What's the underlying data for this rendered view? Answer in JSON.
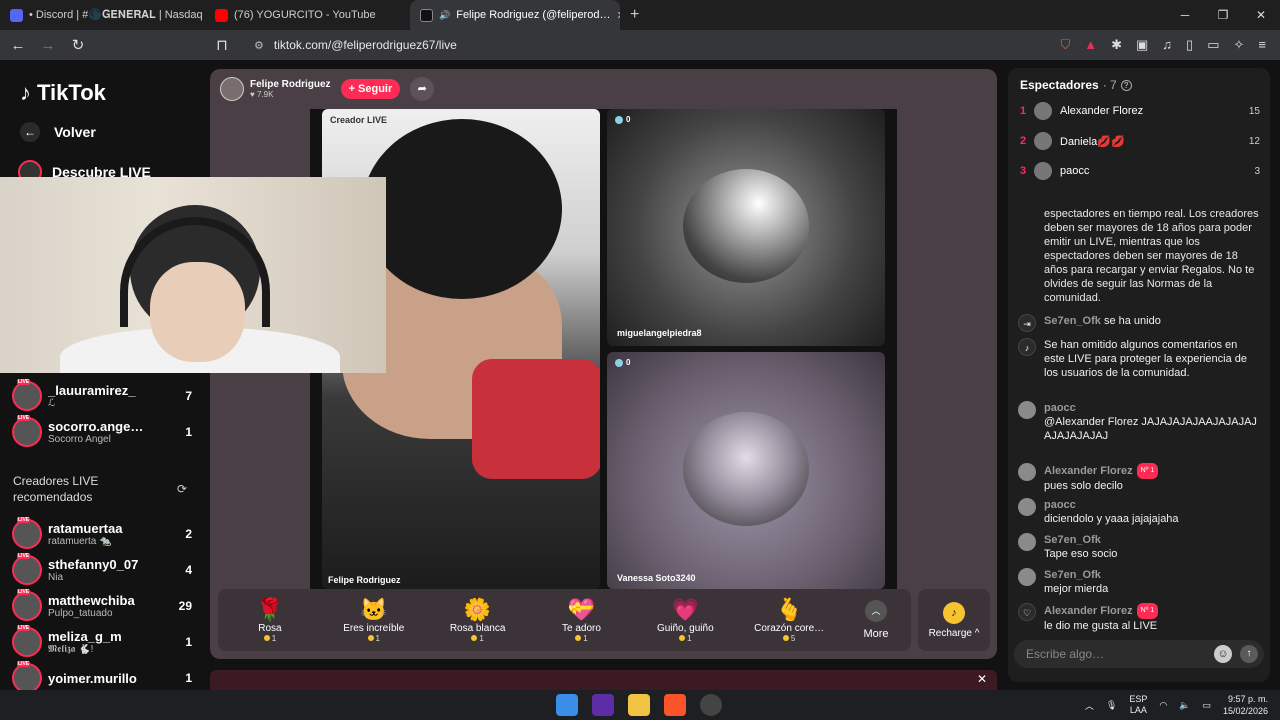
{
  "browser": {
    "tabs": [
      {
        "label": "• Discord | #🌑𝐆𝐄𝐍𝐄𝐑𝐀𝐋 | Nasdaq",
        "icon": "discord-icon",
        "color": "#5865f2"
      },
      {
        "label": "(76) YOGURCITO - YouTube",
        "icon": "youtube-icon",
        "color": "#ff0000"
      },
      {
        "label": "Felipe Rodriguez (@feliperod…",
        "icon": "tiktok-icon",
        "color": "#111111"
      }
    ],
    "new_tab": "+",
    "url": "tiktok.com/@feliperodriguez67/live",
    "shield_count": "7"
  },
  "sidebar": {
    "logo": "TikTok",
    "back": "Volver",
    "discover": "Descubre LIVE",
    "following": [
      {
        "name": "_lauuramirez_",
        "sub": "ℒ",
        "count": "7"
      },
      {
        "name": "socorro.ange…",
        "sub": "Socorro Angel",
        "count": "1"
      }
    ],
    "rec_title": "Creadores LIVE recomendados",
    "recommended": [
      {
        "name": "ratamuertaa",
        "sub": "ratamuerta 🐀",
        "count": "2"
      },
      {
        "name": "sthefanny0_07",
        "sub": "Nia",
        "count": "4"
      },
      {
        "name": "matthewchiba",
        "sub": "Pulpo_tatuado",
        "count": "29"
      },
      {
        "name": "meliza_g_m",
        "sub": "𝕸𝖊𝖑𝖎𝖟𝖆 🐇!",
        "count": "1"
      },
      {
        "name": "yoimer.murillo",
        "sub": "",
        "count": "1"
      }
    ]
  },
  "stream": {
    "host_name": "Felipe Rodriguez",
    "host_likes": "♥ 7.9K",
    "follow": "+ Seguir",
    "creator_tag": "Creador LIVE",
    "host_label": "Felipe Rodriguez",
    "guest1": {
      "name": "miguelangelpiedra8",
      "viewers": "0"
    },
    "guest2": {
      "name": "Vanessa Soto3240",
      "viewers": "0"
    }
  },
  "gifts": [
    {
      "name": "Rosa",
      "icon": "🌹",
      "cost": "1"
    },
    {
      "name": "Eres increíble",
      "icon": "🐱",
      "cost": "1"
    },
    {
      "name": "Rosa blanca",
      "icon": "🌼",
      "cost": "1"
    },
    {
      "name": "Te adoro",
      "icon": "💝",
      "cost": "1"
    },
    {
      "name": "Guiño, guiño",
      "icon": "💗",
      "cost": "1"
    },
    {
      "name": "Corazón core…",
      "icon": "🫰",
      "cost": "5"
    }
  ],
  "more": "More",
  "recharge": "Recharge ^",
  "chat": {
    "header": "Espectadores",
    "viewer_count": "· 7",
    "ranking": [
      {
        "rank": "1",
        "name": "Alexander Florez",
        "score": "15"
      },
      {
        "rank": "2",
        "name": "Daniela💋💋",
        "score": "12"
      },
      {
        "rank": "3",
        "name": "paocc",
        "score": "3"
      }
    ],
    "system_text": "espectadores en tiempo real. Los creadores deben ser mayores de 18 años para poder emitir un LIVE, mientras que los espectadores deben ser mayores de 18 años para recargar y enviar Regalos. No te olvides de seguir las Normas de la comunidad.",
    "messages": [
      {
        "user": "Se7en_Ofk",
        "text": "se ha unido",
        "badge": "",
        "inline": true
      },
      {
        "user": "",
        "text": "Se han omitido algunos comentarios en este LIVE para proteger la experiencia de los usuarios de la comunidad.",
        "badge": "",
        "inline": false
      },
      {
        "user": "paocc",
        "text": "@Alexander Florez JAJAJAJAJAAJAJAJAJAJAJAJAJAJ",
        "badge": "",
        "inline": false
      },
      {
        "user": "Alexander Florez",
        "text": "pues solo decilo",
        "badge": "Nº 1",
        "inline": false
      },
      {
        "user": "paocc",
        "text": "diciendolo y yaaa jajajajaha",
        "badge": "",
        "inline": false
      },
      {
        "user": "Se7en_Ofk",
        "text": "Tape eso socio",
        "badge": "",
        "inline": false
      },
      {
        "user": "Se7en_Ofk",
        "text": "mejor mierda",
        "badge": "",
        "inline": false
      },
      {
        "user": "Alexander Florez",
        "text": "le dio me gusta al LIVE",
        "badge": "Nº 1",
        "inline": false
      }
    ],
    "input_placeholder": "Escribe algo…"
  },
  "taskbar": {
    "lang1": "ESP",
    "lang2": "LAA",
    "time": "9:57 p. m.",
    "date": "15/02/2026"
  },
  "colors": {
    "accent": "#fe2c55",
    "coin": "#f7c430"
  }
}
